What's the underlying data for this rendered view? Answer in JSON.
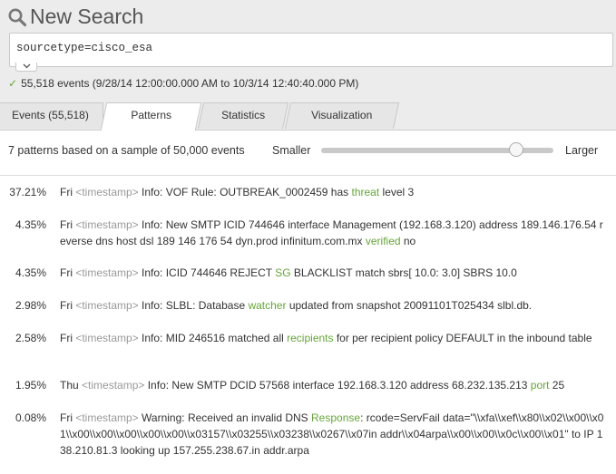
{
  "header": {
    "title": "New Search",
    "search_query": "sourcetype=cisco_esa",
    "status_text": "55,518 events (9/28/14 12:00:00.000 AM to 10/3/14 12:40:40.000 PM)"
  },
  "tabs": [
    {
      "label": "Events (55,518)"
    },
    {
      "label": "Patterns"
    },
    {
      "label": "Statistics"
    },
    {
      "label": "Visualization"
    }
  ],
  "pattern_controls": {
    "summary": "7 patterns based on a sample of 50,000 events",
    "smaller_label": "Smaller",
    "larger_label": "Larger",
    "slider_value": 0.84
  },
  "patterns": [
    {
      "percent": "37.21%",
      "segments": [
        {
          "t": "Fri ",
          "s": "plain"
        },
        {
          "t": "<timestamp>",
          "s": "ts"
        },
        {
          "t": " Info: VOF Rule: OUTBREAK_0002459 has ",
          "s": "plain"
        },
        {
          "t": "threat",
          "s": "kw"
        },
        {
          "t": " level 3",
          "s": "plain"
        }
      ]
    },
    {
      "percent": "4.35%",
      "segments": [
        {
          "t": "Fri ",
          "s": "plain"
        },
        {
          "t": "<timestamp>",
          "s": "ts"
        },
        {
          "t": " Info: New SMTP ICID 744646 interface Management (192.168.3.120) address 189.146.176.54 reverse dns host dsl 189 146 176 54 dyn.prod infinitum.com.mx ",
          "s": "plain"
        },
        {
          "t": "verified",
          "s": "kw"
        },
        {
          "t": " no",
          "s": "plain"
        }
      ]
    },
    {
      "percent": "4.35%",
      "segments": [
        {
          "t": "Fri ",
          "s": "plain"
        },
        {
          "t": "<timestamp>",
          "s": "ts"
        },
        {
          "t": " Info: ICID 744646 REJECT ",
          "s": "plain"
        },
        {
          "t": "SG",
          "s": "kw"
        },
        {
          "t": " BLACKLIST match sbrs[ 10.0: 3.0] SBRS 10.0",
          "s": "plain"
        }
      ]
    },
    {
      "percent": "2.98%",
      "segments": [
        {
          "t": "Fri ",
          "s": "plain"
        },
        {
          "t": "<timestamp>",
          "s": "ts"
        },
        {
          "t": " Info: SLBL: Database ",
          "s": "plain"
        },
        {
          "t": "watcher",
          "s": "kw"
        },
        {
          "t": " updated from snapshot 20091101T025434 slbl.db.",
          "s": "plain"
        }
      ]
    },
    {
      "percent": "2.58%",
      "segments": [
        {
          "t": "Fri ",
          "s": "plain"
        },
        {
          "t": "<timestamp>",
          "s": "ts"
        },
        {
          "t": " Info: MID 246516 matched all ",
          "s": "plain"
        },
        {
          "t": "recipients",
          "s": "kw"
        },
        {
          "t": " for per recipient policy DEFAULT in the inbound table",
          "s": "plain"
        }
      ]
    },
    {
      "percent": "1.95%",
      "segments": [
        {
          "t": "Thu ",
          "s": "plain"
        },
        {
          "t": "<timestamp>",
          "s": "ts"
        },
        {
          "t": " Info: New SMTP DCID 57568 interface 192.168.3.120 address 68.232.135.213 ",
          "s": "plain"
        },
        {
          "t": "port",
          "s": "kw"
        },
        {
          "t": " 25",
          "s": "plain"
        }
      ]
    },
    {
      "percent": "0.08%",
      "segments": [
        {
          "t": "Fri ",
          "s": "plain"
        },
        {
          "t": "<timestamp>",
          "s": "ts"
        },
        {
          "t": " Warning: Received an invalid DNS ",
          "s": "plain"
        },
        {
          "t": "Response",
          "s": "kw"
        },
        {
          "t": ": rcode=ServFail data=\"\\\\xfa\\\\xef\\\\x80\\\\x02\\\\x00\\\\x01\\\\x00\\\\x00\\\\x00\\\\x00\\\\x00\\\\x03157\\\\x03255\\\\x03238\\\\x0267\\\\x07in addr\\\\x04arpa\\\\x00\\\\x00\\\\x0c\\\\x00\\\\x01\" to IP 138.210.81.3 looking up 157.255.238.67.in addr.arpa",
          "s": "plain"
        }
      ]
    }
  ],
  "colors": {
    "accent": "#65a637",
    "timestamp": "#999999"
  }
}
